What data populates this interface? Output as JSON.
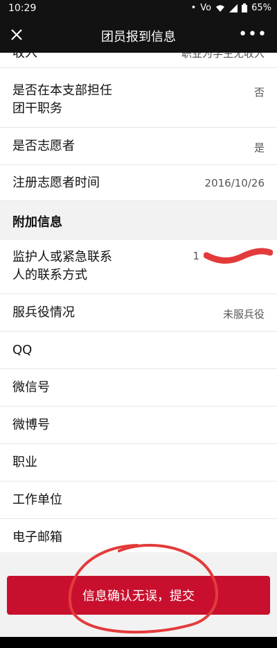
{
  "status_bar": {
    "time": "10:29",
    "network": "Vo",
    "battery": "65%"
  },
  "app_bar": {
    "title": "团员报到信息",
    "close_icon": "close-icon",
    "more_icon": "more-icon"
  },
  "rows": {
    "income": {
      "label": "收入",
      "value": "职业为学生无收入"
    },
    "league_cadre": {
      "label": "是否在本支部担任团干职务",
      "value": "否"
    },
    "volunteer": {
      "label": "是否志愿者",
      "value": "是"
    },
    "volunteer_date": {
      "label": "注册志愿者时间",
      "value": "2016/10/26"
    },
    "guardian_contact": {
      "label": "监护人或紧急联系人的联系方式",
      "value": "1"
    },
    "military": {
      "label": "服兵役情况",
      "value": "未服兵役"
    },
    "qq": {
      "label": "QQ",
      "value": ""
    },
    "wechat": {
      "label": "微信号",
      "value": ""
    },
    "weibo": {
      "label": "微博号",
      "value": ""
    },
    "occupation": {
      "label": "职业",
      "value": ""
    },
    "workplace": {
      "label": "工作单位",
      "value": ""
    },
    "email": {
      "label": "电子邮箱",
      "value": ""
    }
  },
  "sections": {
    "extra_info": "附加信息"
  },
  "submit_label": "信息确认无误，提交",
  "colors": {
    "accent": "#c8102e",
    "annotation": "#e33b3b"
  }
}
